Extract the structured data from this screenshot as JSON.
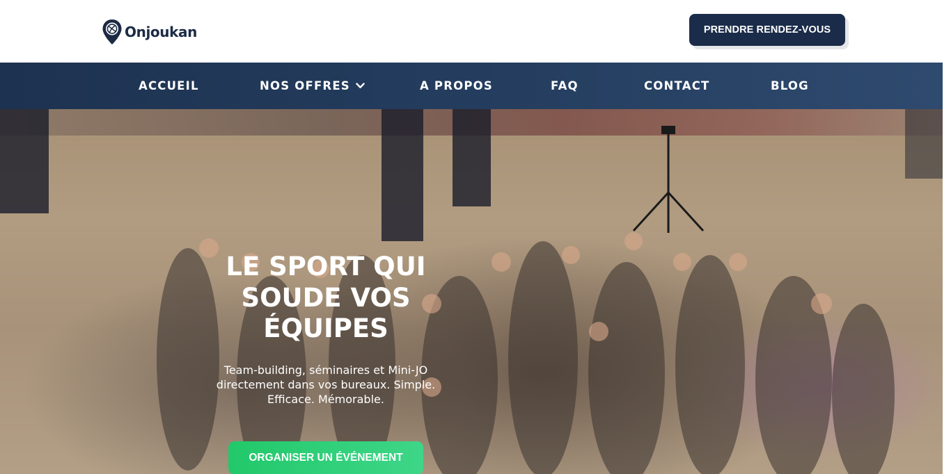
{
  "brand": {
    "name": "Onjoukan",
    "logo_icon": "map-pin-ball-icon"
  },
  "header": {
    "cta_label": "PRENDRE RENDEZ-VOUS"
  },
  "nav": {
    "items": [
      {
        "label": "ACCUEIL"
      },
      {
        "label": "NOS OFFRES",
        "icon": "chevron-down-icon"
      },
      {
        "label": "A PROPOS"
      },
      {
        "label": "FAQ"
      },
      {
        "label": "CONTACT"
      },
      {
        "label": "BLOG"
      }
    ]
  },
  "hero": {
    "title_lines": [
      "LE SPORT QUI",
      "SOUDE VOS",
      "ÉQUIPES"
    ],
    "subtitle_lines": [
      "Team-building, séminaires et Mini-JO",
      "directement dans vos bureaux. Simple.",
      "Efficace. Mémorable."
    ],
    "cta_label": "ORGANISER UN ÉVÉNEMENT",
    "background_image": "group-photo-beach-volleyball-hall"
  },
  "colors": {
    "brand_dark": "#1b2c4a",
    "nav_bg": "#253e60",
    "accent_green": "#2ecc71",
    "white": "#ffffff"
  }
}
